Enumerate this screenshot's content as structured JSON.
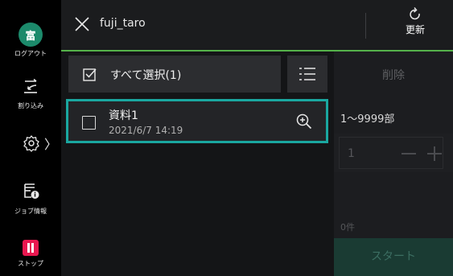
{
  "sidebar": {
    "logo_char": "富",
    "logout_label": "ログアウト",
    "interrupt_label": "割り込み",
    "settings_chevron": "〉",
    "job_info_label": "ジョブ情報",
    "stop_label": "ストップ"
  },
  "header": {
    "user": "fuji_taro",
    "refresh_label": "更新",
    "accent_color": "#55b24a"
  },
  "list": {
    "select_all_label": "すべて選択(1)",
    "items": [
      {
        "name": "資料1",
        "date": "2021/6/7  14:19",
        "selected": true
      }
    ]
  },
  "panel": {
    "delete_label": "削除",
    "range_label": "1〜9999部",
    "quantity": "1",
    "count_label": "0件",
    "start_label": "スタート"
  },
  "colors": {
    "selection_border": "#1aa7a0",
    "stop_red": "#e8174f",
    "logo_green": "#1c8a6b"
  }
}
